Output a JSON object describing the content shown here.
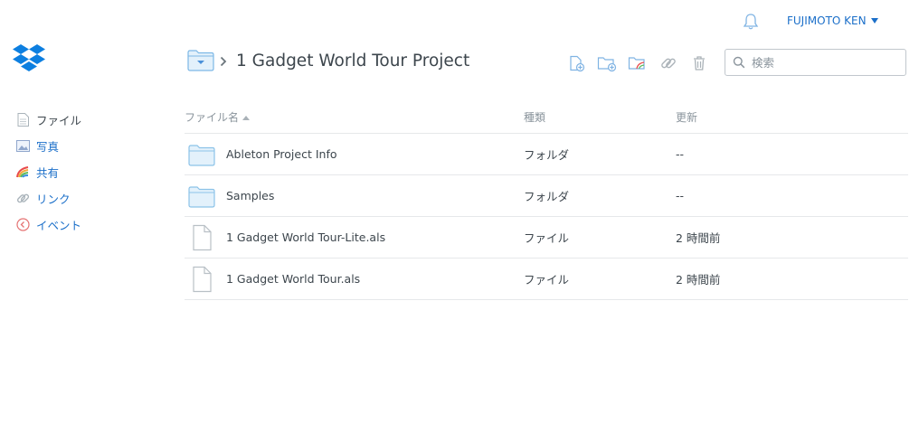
{
  "header": {
    "user_name": "FUJIMOTO KEN",
    "title": "1 Gadget World Tour Project",
    "search_placeholder": "検索"
  },
  "sidebar": {
    "items": [
      {
        "label": "ファイル",
        "icon": "file-icon"
      },
      {
        "label": "写真",
        "icon": "photo-icon"
      },
      {
        "label": "共有",
        "icon": "rainbow-icon"
      },
      {
        "label": "リンク",
        "icon": "link-icon"
      },
      {
        "label": "イベント",
        "icon": "event-icon"
      }
    ]
  },
  "table": {
    "headers": {
      "name": "ファイル名",
      "kind": "種類",
      "modified": "更新"
    },
    "rows": [
      {
        "name": "Ableton Project Info",
        "kind": "フォルダ",
        "modified": "--",
        "icon": "folder-icon"
      },
      {
        "name": "Samples",
        "kind": "フォルダ",
        "modified": "--",
        "icon": "folder-icon"
      },
      {
        "name": "1 Gadget World Tour-Lite.als",
        "kind": "ファイル",
        "modified": "2 時間前",
        "icon": "file-icon"
      },
      {
        "name": "1 Gadget World Tour.als",
        "kind": "ファイル",
        "modified": "2 時間前",
        "icon": "file-icon"
      }
    ]
  },
  "colors": {
    "accent": "#1b6fc9",
    "folder_fill": "#e3f1fb",
    "folder_stroke": "#8cc3e8",
    "text": "#3d464d",
    "muted": "#8a949c"
  }
}
